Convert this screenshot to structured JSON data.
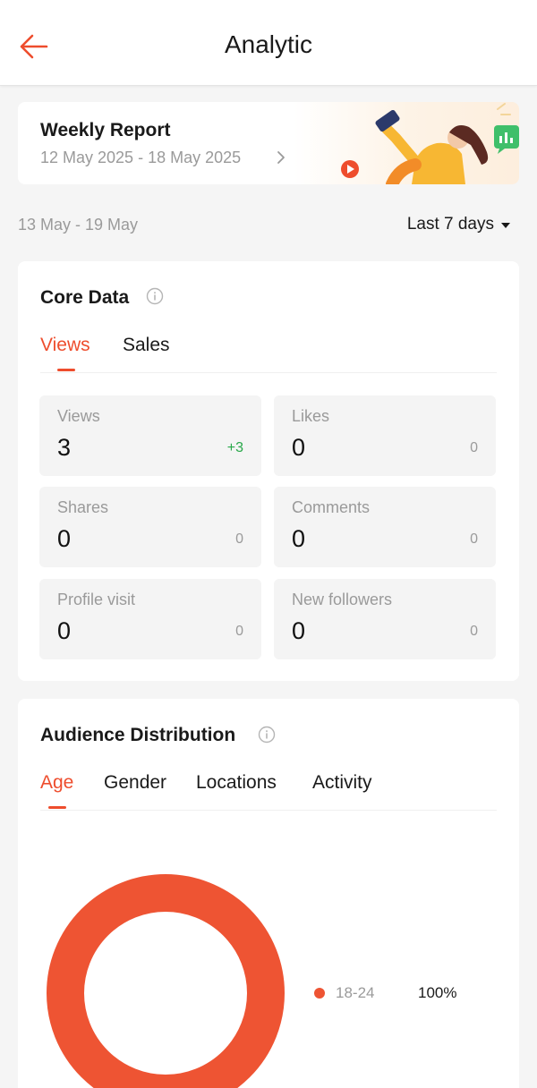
{
  "header": {
    "title": "Analytic",
    "back_icon": "arrow-left-icon",
    "accent_color": "#ee4d2d"
  },
  "weekly_report": {
    "title": "Weekly Report",
    "range": "12 May 2025 - 18 May 2025",
    "chevron_icon": "chevron-right-icon"
  },
  "filter": {
    "date_range": "13 May - 19 May",
    "period": "Last 7 days"
  },
  "core_data": {
    "title": "Core Data",
    "tabs": [
      {
        "label": "Views",
        "active": true
      },
      {
        "label": "Sales",
        "active": false
      }
    ],
    "metrics": [
      {
        "label": "Views",
        "value": "3",
        "delta": "+3",
        "positive": true
      },
      {
        "label": "Likes",
        "value": "0",
        "delta": "0",
        "positive": false
      },
      {
        "label": "Shares",
        "value": "0",
        "delta": "0",
        "positive": false
      },
      {
        "label": "Comments",
        "value": "0",
        "delta": "0",
        "positive": false
      },
      {
        "label": "Profile visit",
        "value": "0",
        "delta": "0",
        "positive": false
      },
      {
        "label": "New followers",
        "value": "0",
        "delta": "0",
        "positive": false
      }
    ]
  },
  "audience": {
    "title": "Audience Distribution",
    "tabs": [
      {
        "label": "Age",
        "active": true
      },
      {
        "label": "Gender",
        "active": false
      },
      {
        "label": "Locations",
        "active": false
      },
      {
        "label": "Activity",
        "active": false
      }
    ],
    "legend": [
      {
        "label": "18-24",
        "value": "100%",
        "fraction": 1.0,
        "color": "#ee5433"
      }
    ]
  },
  "colors": {
    "positive": "#29a84a",
    "muted": "#9a9a9a",
    "tile": "#f4f4f4"
  }
}
